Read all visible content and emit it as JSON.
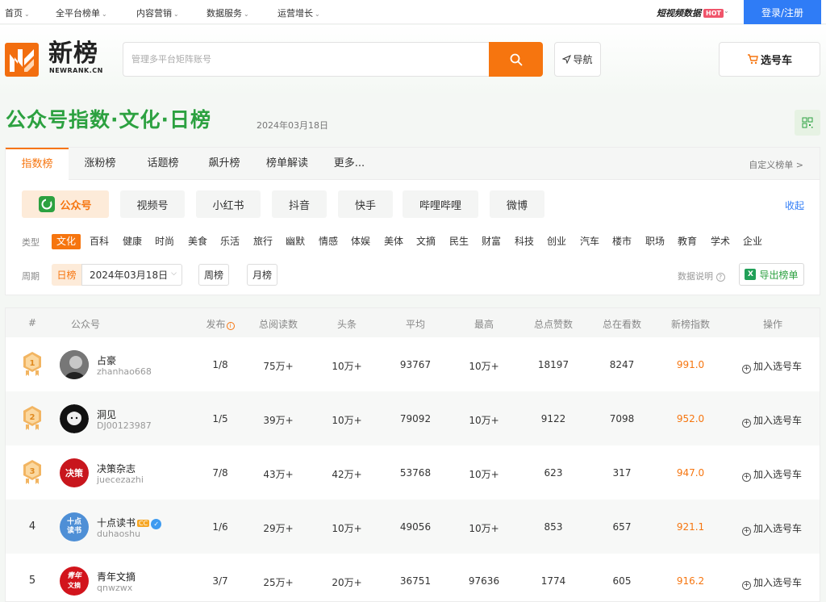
{
  "topnav": {
    "items": [
      {
        "label": "首页"
      },
      {
        "label": "全平台榜单"
      },
      {
        "label": "内容营销"
      },
      {
        "label": "数据服务"
      },
      {
        "label": "运营增长"
      }
    ],
    "short_video_label": "短视频数据",
    "hot_badge": "HOT",
    "login_label": "登录/注册"
  },
  "header": {
    "logo_text": "新榜",
    "logo_sub": "NEWRANK.CN",
    "search_placeholder": "管理多平台矩阵账号",
    "guide_label": "导航",
    "cart_label": "选号车"
  },
  "page": {
    "title": "公众号指数·文化·日榜",
    "date": "2024年03月18日"
  },
  "tabs": [
    {
      "label": "指数榜",
      "active": true
    },
    {
      "label": "涨粉榜"
    },
    {
      "label": "话题榜"
    },
    {
      "label": "飙升榜"
    },
    {
      "label": "榜单解读"
    },
    {
      "label": "更多..."
    }
  ],
  "custom_rank_label": "自定义榜单 >",
  "platforms": [
    {
      "label": "公众号",
      "active": true
    },
    {
      "label": "视频号"
    },
    {
      "label": "小红书"
    },
    {
      "label": "抖音"
    },
    {
      "label": "快手"
    },
    {
      "label": "哔哩哔哩"
    },
    {
      "label": "微博"
    }
  ],
  "collapse_label": "收起",
  "type_label": "类型",
  "categories": [
    "文化",
    "百科",
    "健康",
    "时尚",
    "美食",
    "乐活",
    "旅行",
    "幽默",
    "情感",
    "体娱",
    "美体",
    "文摘",
    "民生",
    "财富",
    "科技",
    "创业",
    "汽车",
    "楼市",
    "职场",
    "教育",
    "学术",
    "企业"
  ],
  "active_category": "文化",
  "period": {
    "label": "周期",
    "daily": "日榜",
    "date": "2024年03月18日",
    "weekly": "周榜",
    "monthly": "月榜"
  },
  "data_desc_label": "数据说明",
  "export_label": "导出榜单",
  "table": {
    "headers": [
      "#",
      "公众号",
      "发布",
      "总阅读数",
      "头条",
      "平均",
      "最高",
      "总点赞数",
      "总在看数",
      "新榜指数",
      "操作"
    ],
    "add_label": "加入选号车",
    "rows": [
      {
        "rank": "1",
        "name": "占豪",
        "id": "zhanhao668",
        "publish": "1/8",
        "total_reads": "75万+",
        "headline": "10万+",
        "avg": "93767",
        "max": "10万+",
        "likes": "18197",
        "watching": "8247",
        "index": "991.0"
      },
      {
        "rank": "2",
        "name": "洞见",
        "id": "DJ00123987",
        "publish": "1/5",
        "total_reads": "39万+",
        "headline": "10万+",
        "avg": "79092",
        "max": "10万+",
        "likes": "9122",
        "watching": "7098",
        "index": "952.0"
      },
      {
        "rank": "3",
        "name": "决策杂志",
        "id": "juecezazhi",
        "publish": "7/8",
        "total_reads": "43万+",
        "headline": "42万+",
        "avg": "53768",
        "max": "10万+",
        "likes": "623",
        "watching": "317",
        "index": "947.0"
      },
      {
        "rank": "4",
        "name": "十点读书",
        "id": "duhaoshu",
        "publish": "1/6",
        "total_reads": "29万+",
        "headline": "10万+",
        "avg": "49056",
        "max": "10万+",
        "likes": "853",
        "watching": "657",
        "index": "921.1"
      },
      {
        "rank": "5",
        "name": "青年文摘",
        "id": "qnwzwx",
        "publish": "3/7",
        "total_reads": "25万+",
        "headline": "20万+",
        "avg": "36751",
        "max": "97636",
        "likes": "1774",
        "watching": "605",
        "index": "916.2"
      }
    ]
  },
  "avatar_text": {
    "r3": "决策",
    "r4a": "十点",
    "r4b": "读书",
    "r5a": "青年",
    "r5b": "文摘"
  },
  "badges": {
    "cc": "CC",
    "verified": "✓"
  },
  "colors": {
    "brand_orange": "#f6750f",
    "brand_green": "#2ca140",
    "link_blue": "#2f7cf6"
  }
}
